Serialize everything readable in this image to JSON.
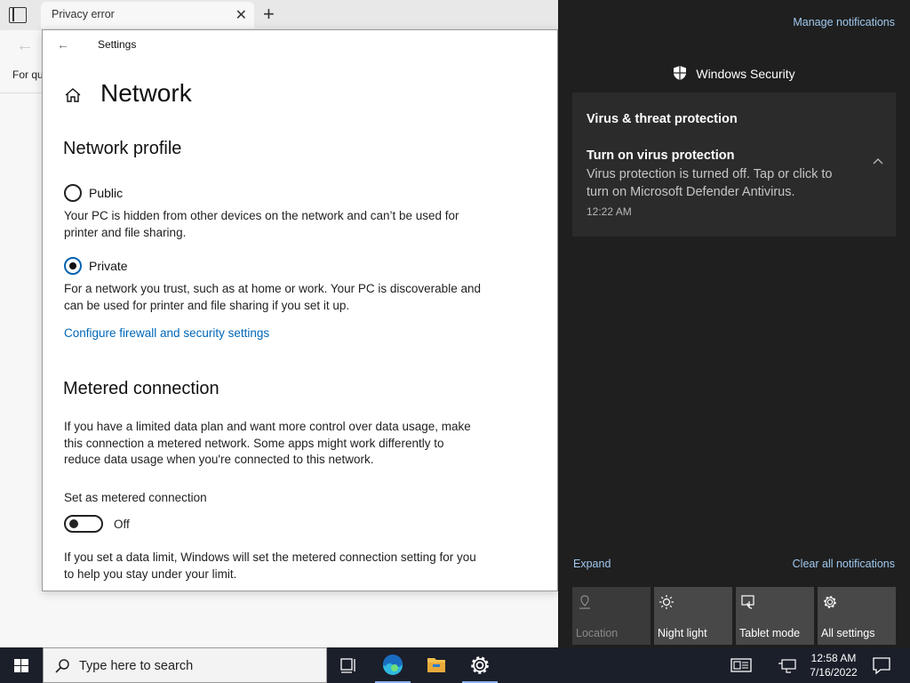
{
  "browser": {
    "tab_title": "Privacy error",
    "favorites_text": "For qu"
  },
  "settings": {
    "window_title": "Settings",
    "page_title": "Network",
    "network_profile": {
      "heading": "Network profile",
      "public_label": "Public",
      "public_desc": "Your PC is hidden from other devices on the network and can’t be used for printer and file sharing.",
      "private_label": "Private",
      "private_desc": "For a network you trust, such as at home or work. Your PC is discoverable and can be used for printer and file sharing if you set it up.",
      "selected": "Private",
      "firewall_link": "Configure firewall and security settings"
    },
    "metered": {
      "heading": "Metered connection",
      "desc": "If you have a limited data plan and want more control over data usage, make this connection a metered network. Some apps might work differently to reduce data usage when you're connected to this network.",
      "toggle_label": "Set as metered connection",
      "toggle_state": "Off",
      "limit_desc": "If you set a data limit, Windows will set the metered connection setting for you to help you stay under your limit."
    }
  },
  "action_center": {
    "manage_notifications": "Manage notifications",
    "app_header": "Windows Security",
    "notification": {
      "group": "Virus & threat protection",
      "title": "Turn on virus protection",
      "body": "Virus protection is turned off. Tap or click to turn on Microsoft Defender Antivirus.",
      "time": "12:22 AM"
    },
    "expand": "Expand",
    "clear_all": "Clear all notifications",
    "quick_actions": [
      {
        "label": "Location",
        "icon": "location-icon",
        "enabled": false
      },
      {
        "label": "Night light",
        "icon": "night-light-icon",
        "enabled": true
      },
      {
        "label": "Tablet mode",
        "icon": "tablet-mode-icon",
        "enabled": true
      },
      {
        "label": "All settings",
        "icon": "gear-icon",
        "enabled": true
      }
    ]
  },
  "taskbar": {
    "search_placeholder": "Type here to search",
    "time": "12:58 AM",
    "date": "7/16/2022"
  },
  "colors": {
    "accent": "#0067b8",
    "action_center_bg": "#1f1f1f",
    "taskbar_bg": "#1b1f2a"
  }
}
